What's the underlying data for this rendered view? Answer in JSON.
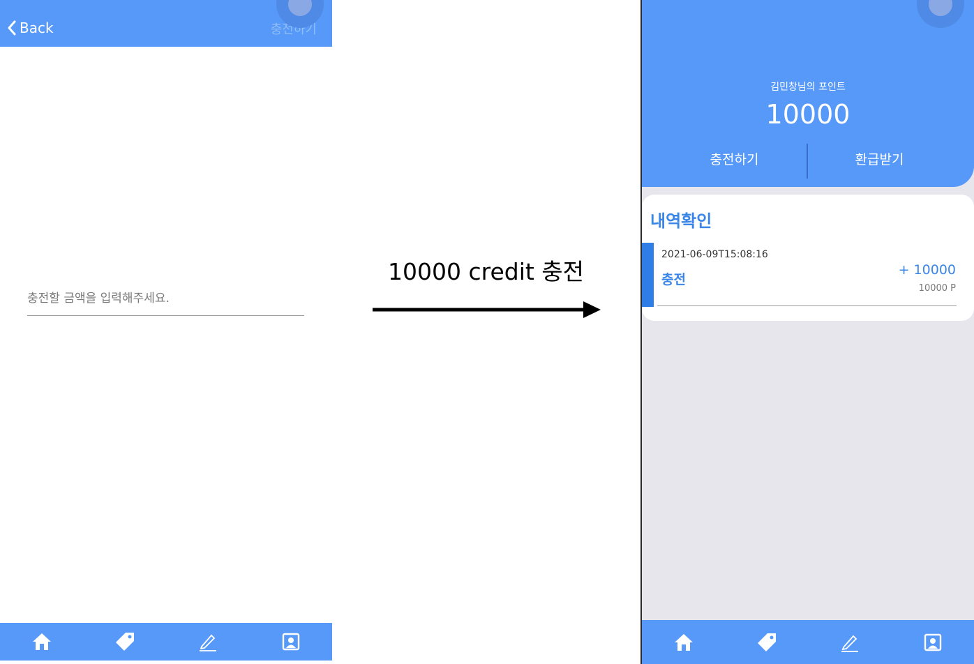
{
  "left": {
    "back_label": "Back",
    "header_action": "충전하기",
    "amount_placeholder": "충전할 금액을 입력해주세요."
  },
  "transition": {
    "label": "10000 credit 충전"
  },
  "right": {
    "owner_label": "김민창님의 포인트",
    "balance": "10000",
    "charge_label": "충전하기",
    "refund_label": "환급받기",
    "history_title": "내역확인",
    "history": [
      {
        "date": "2021-06-09T15:08:16",
        "type": "충전",
        "amount": "+ 10000",
        "balance": "10000 P"
      }
    ]
  },
  "tabbar": [
    "home-icon",
    "tag-icon",
    "pencil-icon",
    "profile-icon"
  ],
  "colors": {
    "primary": "#5799f8",
    "accent": "#3a86e8",
    "background": "#e6e6ec"
  }
}
